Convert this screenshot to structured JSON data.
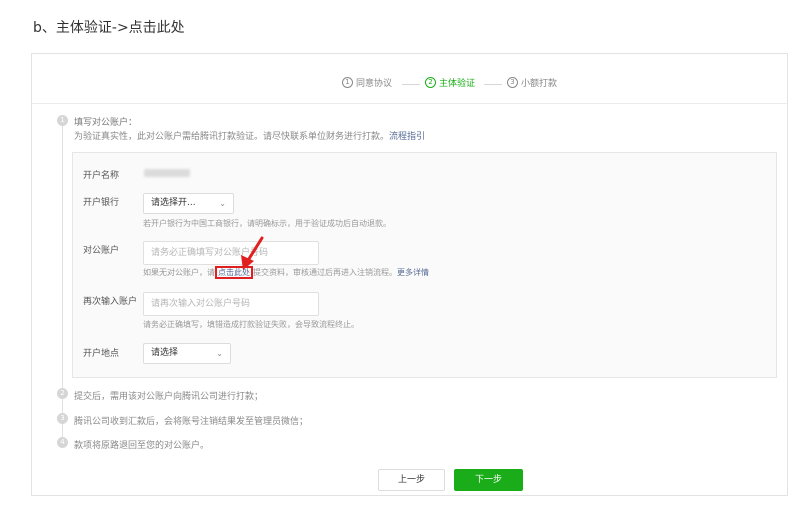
{
  "heading": "b、主体验证->点击此处",
  "steps": [
    {
      "num": "1",
      "label": "同意协议",
      "active": false
    },
    {
      "num": "2",
      "label": "主体验证",
      "active": true
    },
    {
      "num": "3",
      "label": "小额打款",
      "active": false
    }
  ],
  "items": [
    {
      "num": "1",
      "title": "填写对公账户：",
      "desc": "为验证真实性，此对公账户需给腾讯打款验证。请尽快联系单位财务进行打款。",
      "link": "流程指引"
    },
    {
      "num": "2",
      "text": "提交后，需用该对公账户向腾讯公司进行打款；"
    },
    {
      "num": "3",
      "text": "腾讯公司收到汇款后，会将账号注销结果发至管理员微信；"
    },
    {
      "num": "4",
      "text": "款项将原路退回至您的对公账户。"
    }
  ],
  "form": {
    "account_name_label": "开户名称",
    "account_name_value": "",
    "bank_label": "开户银行",
    "bank_select": "请选择开...",
    "bank_hint": "若开户银行为中国工商银行，请明确标示，用于验证成功后自动退款。",
    "account_label": "对公账户",
    "account_placeholder": "请务必正确填写对公账户号码",
    "account_hint_pre": "如果无对公账户，请",
    "account_hint_link": "点击此处",
    "account_hint_post": "提交资料，审核通过后再进入注销流程。",
    "account_hint_more": "更多详情",
    "re_account_label": "再次输入账户",
    "re_account_placeholder": "请再次输入对公账户号码",
    "re_account_hint": "请务必正确填写，填错造成打款验证失败，会导致流程终止。",
    "location_label": "开户地点",
    "location_select": "请选择"
  },
  "buttons": {
    "prev": "上一步",
    "next": "下一步"
  },
  "colors": {
    "accent": "#1aad19",
    "link": "#576b95",
    "highlight": "#e02020"
  }
}
